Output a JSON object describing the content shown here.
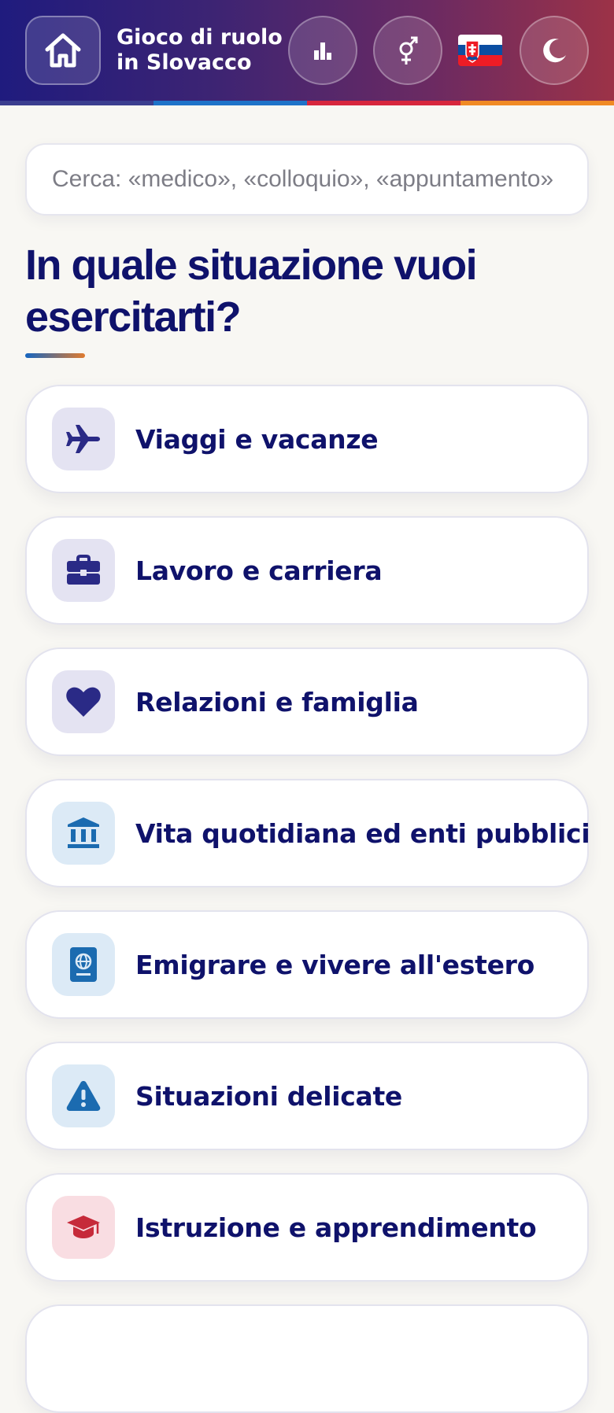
{
  "header": {
    "title_line1": "Gioco di ruolo",
    "title_line2": "in Slovacco",
    "home_icon": "home-icon",
    "stats_icon": "bar-chart-icon",
    "gender_icon": "gender-icon",
    "language_flag": "slovakia-flag",
    "theme_icon": "moon-icon",
    "gradient_colors": [
      "#1f1b7e",
      "#9c3247"
    ],
    "stripe_colors": [
      "#3b3e8f",
      "#1e73c8",
      "#d7263d",
      "#f08a24"
    ]
  },
  "search": {
    "placeholder": "Cerca: «medico», «colloquio», «appuntamento»",
    "value": ""
  },
  "main": {
    "heading": "In quale situazione vuoi esercitarti?",
    "categories": [
      {
        "label": "Viaggi e vacanze",
        "icon": "airplane-icon",
        "color": "purple"
      },
      {
        "label": "Lavoro e carriera",
        "icon": "briefcase-icon",
        "color": "purple"
      },
      {
        "label": "Relazioni e famiglia",
        "icon": "heart-icon",
        "color": "purple"
      },
      {
        "label": "Vita quotidiana ed enti pubblici",
        "icon": "government-building-icon",
        "color": "blue"
      },
      {
        "label": "Emigrare e vivere all'estero",
        "icon": "passport-icon",
        "color": "blue"
      },
      {
        "label": "Situazioni delicate",
        "icon": "warning-icon",
        "color": "blue"
      },
      {
        "label": "Istruzione e apprendimento",
        "icon": "graduation-cap-icon",
        "color": "red"
      }
    ]
  },
  "colors": {
    "primary_text": "#0f126b",
    "background": "#f8f7f3"
  }
}
